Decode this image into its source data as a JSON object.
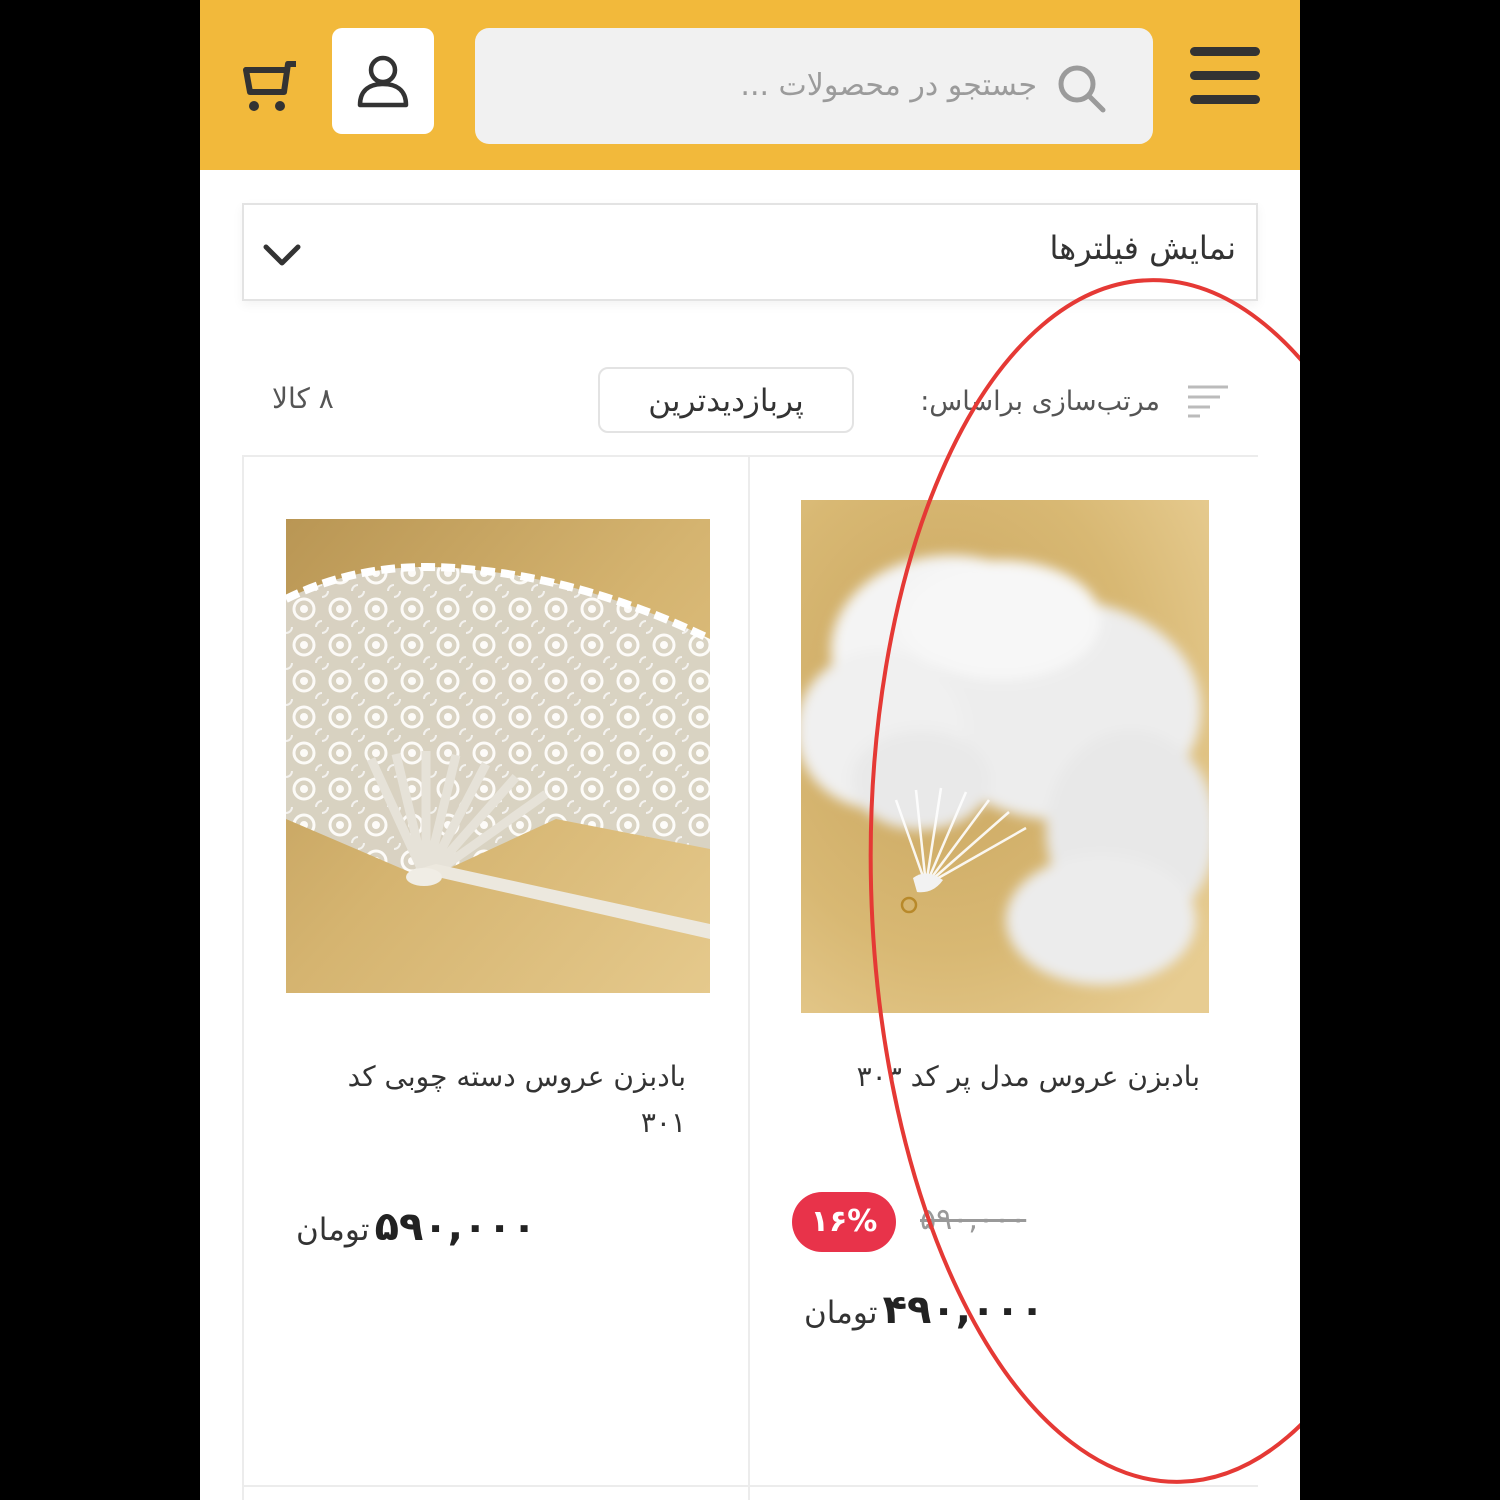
{
  "header": {
    "search_placeholder": "جستجو در محصولات ...",
    "icons": [
      "hamburger-menu-icon",
      "search-icon",
      "user-icon",
      "cart-icon"
    ],
    "accent_color": "#f2b93b"
  },
  "filters": {
    "label": "نمایش فیلترها"
  },
  "sort": {
    "label": "مرتب‌سازی براساس:",
    "selected": "پربازدیدترین",
    "item_count": "۸ کالا"
  },
  "products": [
    {
      "title": "بادبزن عروس مدل پر کد ۳۰۳",
      "old_price": "۵۹۰,۰۰۰",
      "discount": "۱۶%",
      "price": "۴۹۰,۰۰۰",
      "currency": "تومان",
      "image": "white-feather-fan"
    },
    {
      "title": "بادبزن عروس دسته چوبی کد ۳۰۱",
      "price": "۵۹۰,۰۰۰",
      "currency": "تومان",
      "image": "white-lace-fan"
    }
  ],
  "colors": {
    "discount_badge": "#e8334a",
    "annotation": "#e53935"
  }
}
